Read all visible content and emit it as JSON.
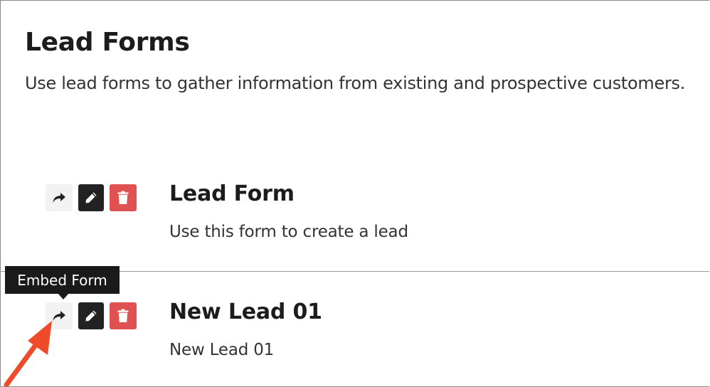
{
  "page": {
    "title": "Lead Forms",
    "description": "Use lead forms to gather information from existing and prospective customers."
  },
  "forms": [
    {
      "title": "Lead Form",
      "description": "Use this form to create a lead"
    },
    {
      "title": "New Lead 01",
      "description": "New Lead 01"
    }
  ],
  "actions": {
    "embed_icon": "share-arrow-icon",
    "edit_icon": "pencil-icon",
    "delete_icon": "trash-icon"
  },
  "tooltip": {
    "text": "Embed Form"
  },
  "colors": {
    "embed_bg": "#f2f2f2",
    "edit_bg": "#222222",
    "delete_bg": "#e05252",
    "tooltip_bg": "#1a1a1a",
    "annotation_arrow": "#ee4b2b"
  }
}
